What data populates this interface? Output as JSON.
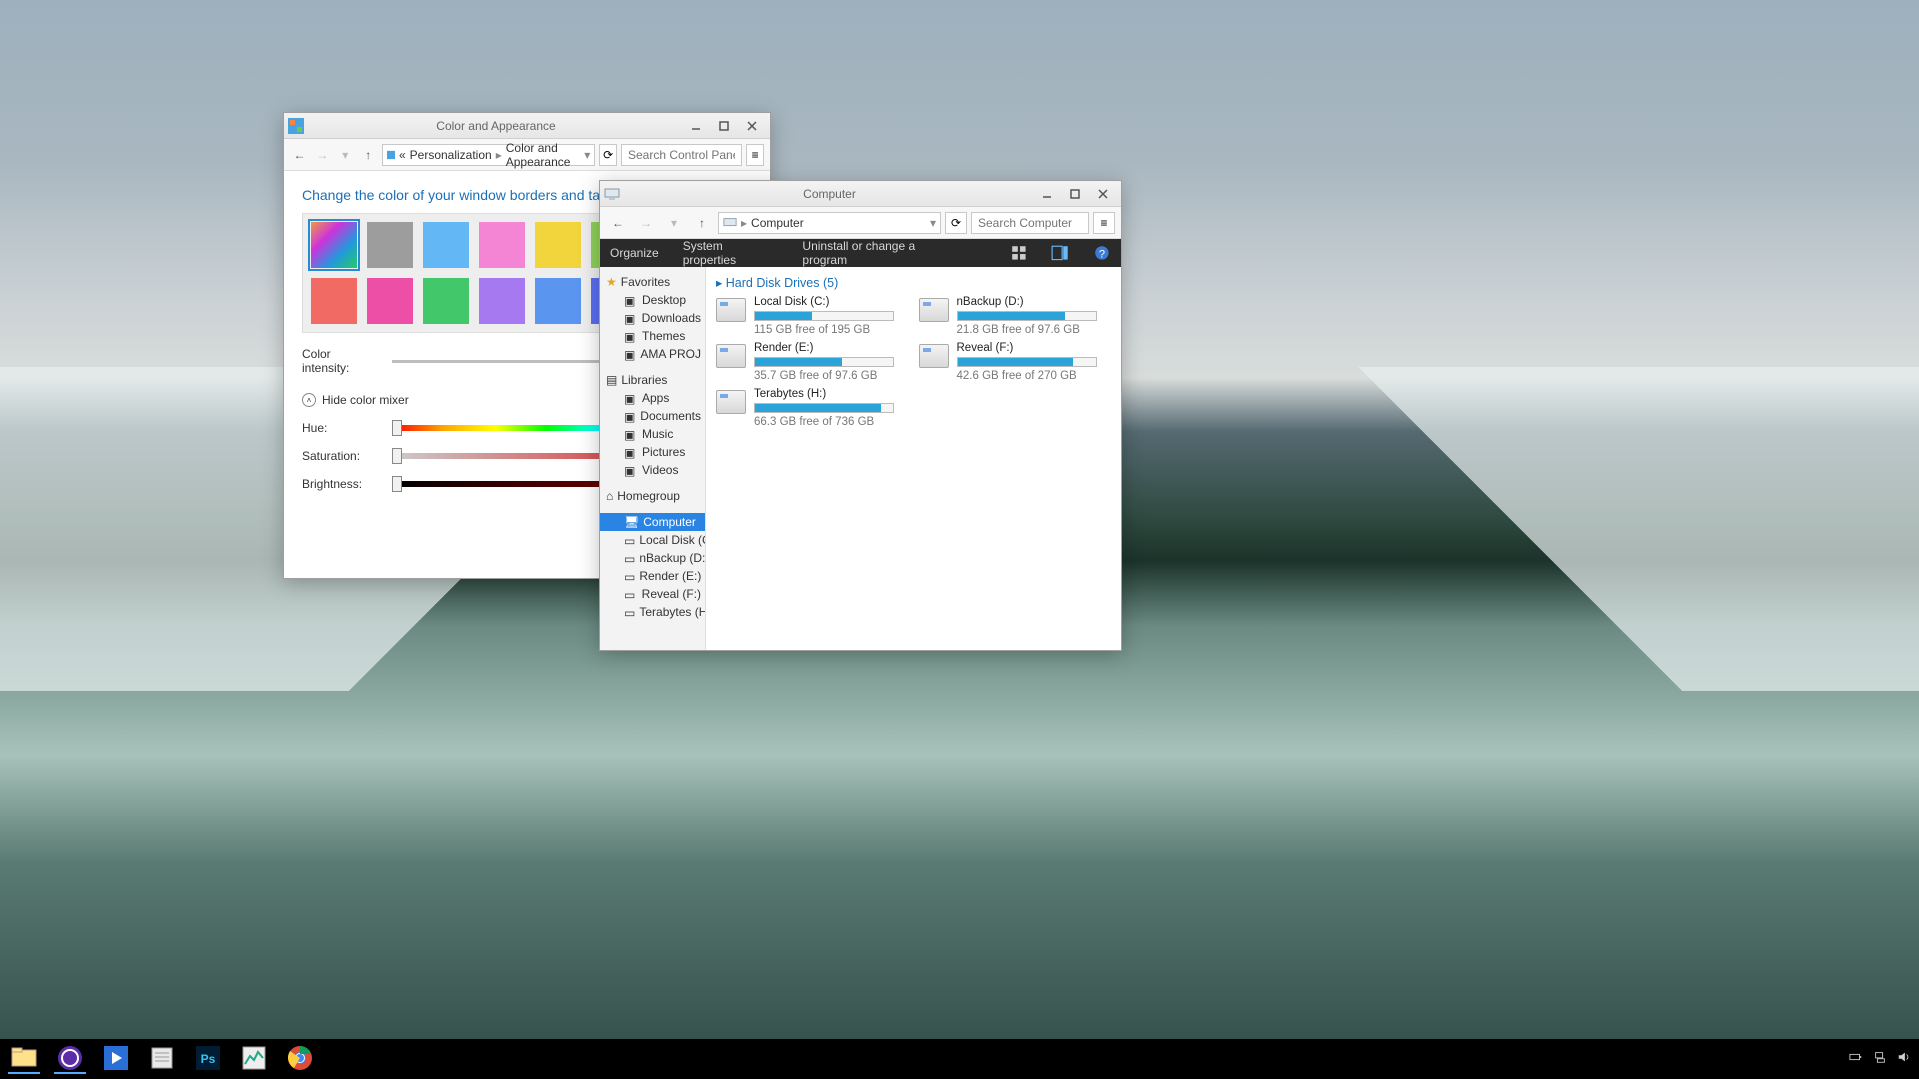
{
  "colorWindow": {
    "title": "Color and Appearance",
    "breadcrumbs": {
      "prefix": "«",
      "a": "Personalization",
      "b": "Color and Appearance"
    },
    "searchPlaceholder": "Search Control Panel",
    "heading": "Change the color of your window borders and taskbar",
    "intensityLabel": "Color intensity:",
    "mixerToggle": "Hide color mixer",
    "hueLabel": "Hue:",
    "satLabel": "Saturation:",
    "briLabel": "Brightness:",
    "swatchColors": [
      "auto",
      "#9d9d9d",
      "#63b7f5",
      "#f485d4",
      "#f2d43c",
      "#8fd15a",
      "#f16a63",
      "#ee4fa6",
      "#43c76b",
      "#a679f0",
      "#5a95f0",
      "#5a6ef0"
    ]
  },
  "computerWindow": {
    "title": "Computer",
    "breadcrumb": "Computer",
    "searchPlaceholder": "Search Computer",
    "toolbar": {
      "organize": "Organize",
      "sysprops": "System properties",
      "uninstall": "Uninstall or change a program"
    },
    "nav": {
      "favorites": "Favorites",
      "favItems": [
        "Desktop",
        "Downloads",
        "Themes",
        "AMA PROJ"
      ],
      "libraries": "Libraries",
      "libItems": [
        "Apps",
        "Documents",
        "Music",
        "Pictures",
        "Videos"
      ],
      "homegroup": "Homegroup",
      "computer": "Computer",
      "drives": [
        "Local Disk (C:)",
        "nBackup (D:)",
        "Render (E:)",
        "Reveal (F:)",
        "Terabytes (H:)"
      ]
    },
    "sectionHeader": "Hard Disk Drives (5)",
    "drives": [
      {
        "name": "Local Disk (C:)",
        "free": "115 GB free of 195 GB",
        "fill": 41
      },
      {
        "name": "nBackup (D:)",
        "free": "21.8 GB free of 97.6 GB",
        "fill": 78
      },
      {
        "name": "Render (E:)",
        "free": "35.7 GB free of 97.6 GB",
        "fill": 63
      },
      {
        "name": "Reveal (F:)",
        "free": "42.6 GB free of 270 GB",
        "fill": 84
      },
      {
        "name": "Terabytes (H:)",
        "free": "66.3 GB free of 736 GB",
        "fill": 91
      }
    ]
  },
  "taskbar": {
    "apps": [
      "explorer",
      "bittorrent",
      "windows-media",
      "notepad",
      "photoshop",
      "task-manager",
      "chrome"
    ]
  }
}
